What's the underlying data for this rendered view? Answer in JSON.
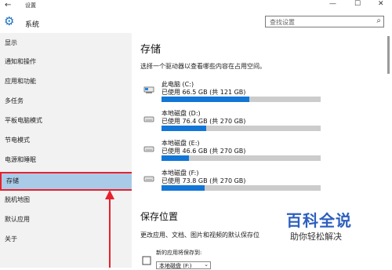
{
  "titlebar": {
    "title": "设置"
  },
  "header": {
    "app_title": "系统"
  },
  "search": {
    "placeholder": "查找设置"
  },
  "sidebar": {
    "items": [
      {
        "label": "显示"
      },
      {
        "label": "通知和操作"
      },
      {
        "label": "应用和功能"
      },
      {
        "label": "多任务"
      },
      {
        "label": "平板电脑模式"
      },
      {
        "label": "节电模式"
      },
      {
        "label": "电源和睡眠"
      },
      {
        "label": "存储",
        "selected": true
      },
      {
        "label": "脱机地图"
      },
      {
        "label": "默认应用"
      },
      {
        "label": "关于"
      }
    ]
  },
  "main": {
    "title": "存储",
    "description": "选择一个驱动器以查看哪些内容在占用空间。",
    "drives": [
      {
        "name": "此电脑 (C:)",
        "usage": "已使用 66.5 GB (共 121 GB)",
        "used_fraction": 0.55,
        "icon": "pc-drive-icon"
      },
      {
        "name": "本地磁盘 (D:)",
        "usage": "已使用 76.4 GB (共 270 GB)",
        "used_fraction": 0.28,
        "icon": "disk-drive-icon"
      },
      {
        "name": "本地磁盘 (E:)",
        "usage": "已使用 46.6 GB (共 270 GB)",
        "used_fraction": 0.17,
        "icon": "disk-drive-icon"
      },
      {
        "name": "本地磁盘 (F:)",
        "usage": "已使用 73.8 GB (共 270 GB)",
        "used_fraction": 0.27,
        "icon": "disk-drive-icon"
      }
    ],
    "save_locations_title": "保存位置",
    "save_locations_desc": "更改应用、文档、图片和视频的默认保存位",
    "new_apps_label": "新的应用将保存到:",
    "new_apps_value": "本地磁盘 (F:)"
  },
  "watermark": {
    "main": "百科全说",
    "sub": "助你轻松解决"
  },
  "colors": {
    "accent": "#1176d6",
    "selection": "#a9cbe8",
    "highlight_border": "#e8212c",
    "arrow": "#e8212c"
  }
}
